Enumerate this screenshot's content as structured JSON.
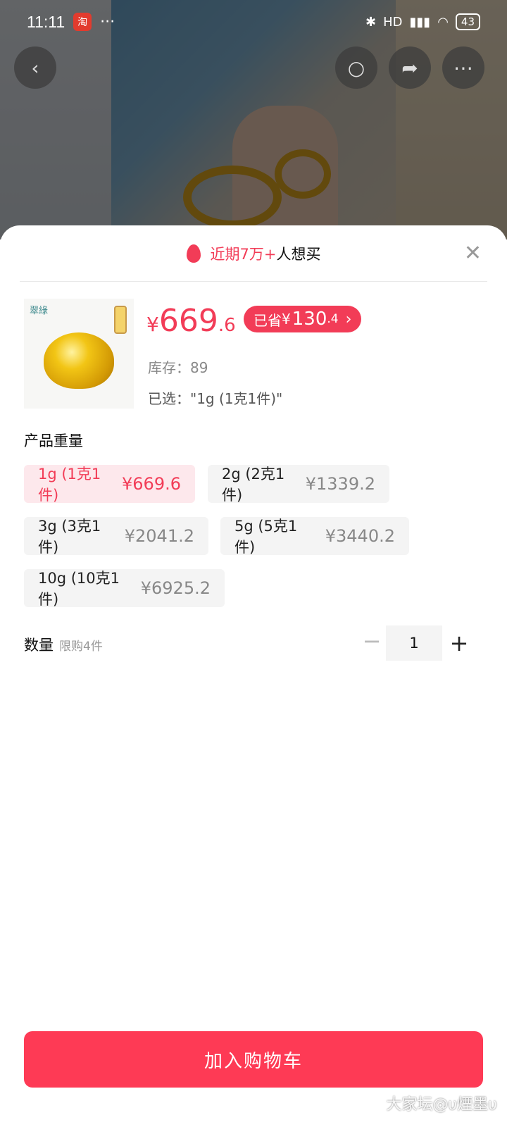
{
  "status_bar": {
    "time": "11:11",
    "app_badge": "淘",
    "more": "···",
    "signal_label": "HD",
    "battery": "43"
  },
  "header": {
    "hot_text": "近期7万+",
    "hot_suffix": "人想买",
    "close": "✕"
  },
  "product": {
    "brand_mark": "翠綠",
    "price_yen": "¥",
    "price_int": "669",
    "price_dec": ".6",
    "saved_label": "已省",
    "saved_yen": "¥",
    "saved_int": "130",
    "saved_dec": ".4",
    "stock_label": "库存：",
    "stock_value": "89",
    "selected_label": "已选：",
    "selected_value": "\"1g (1克1件)\""
  },
  "weight_section": {
    "title": "产品重量",
    "options": [
      {
        "label": "1g (1克1件)",
        "price": "¥669.6",
        "selected": true
      },
      {
        "label": "2g (2克1件)",
        "price": "¥1339.2",
        "selected": false
      },
      {
        "label": "3g (3克1件)",
        "price": "¥2041.2",
        "selected": false
      },
      {
        "label": "5g (5克1件)",
        "price": "¥3440.2",
        "selected": false
      },
      {
        "label": "10g (10克1件)",
        "price": "¥6925.2",
        "selected": false
      }
    ]
  },
  "quantity": {
    "label": "数量",
    "limit": "限购4件",
    "value": "1",
    "minus": "−",
    "plus": "+"
  },
  "cta": {
    "label": "加入购物车"
  },
  "watermark": "大家坛@υ煙墨υ",
  "colors": {
    "accent": "#f23c57",
    "cta": "#fe3a55",
    "selected_bg": "#fde8ec"
  }
}
